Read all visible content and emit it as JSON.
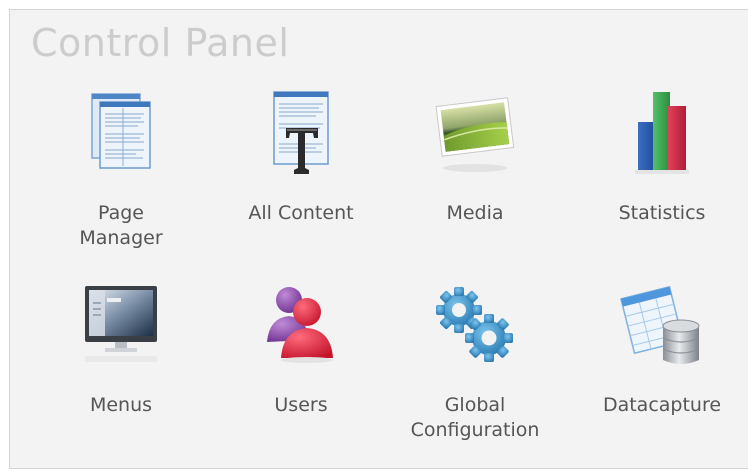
{
  "panel": {
    "title": "Control Panel"
  },
  "items": [
    {
      "label": "Page\nManager",
      "icon": "page-manager-icon"
    },
    {
      "label": "All Content",
      "icon": "all-content-icon"
    },
    {
      "label": "Media",
      "icon": "media-icon"
    },
    {
      "label": "Statistics",
      "icon": "statistics-icon"
    },
    {
      "label": "Menus",
      "icon": "menus-icon"
    },
    {
      "label": "Users",
      "icon": "users-icon"
    },
    {
      "label": "Global\nConfiguration",
      "icon": "global-configuration-icon"
    },
    {
      "label": "Datacapture",
      "icon": "datacapture-icon"
    }
  ],
  "colors": {
    "panel_background": "#f3f3f3",
    "title": "#cccccc",
    "label": "#555555"
  }
}
